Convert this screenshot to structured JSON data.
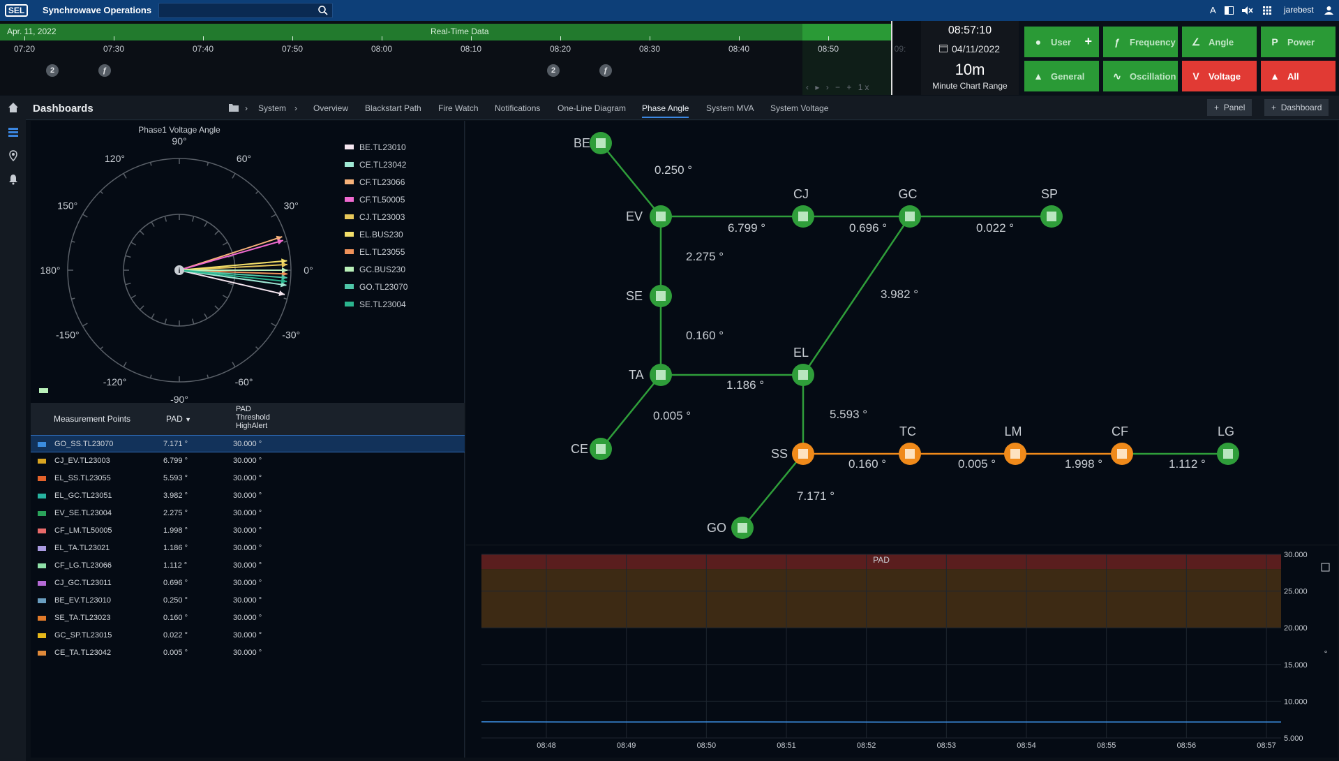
{
  "topbar": {
    "logo": "SEL",
    "app_title": "Synchrowave Operations",
    "search_placeholder": "",
    "text_size_icon": "A",
    "user": "jarebest"
  },
  "timeline": {
    "date": "Apr. 11, 2022",
    "mode": "Real-Time Data",
    "ticks": [
      "07:20",
      "07:30",
      "07:40",
      "07:50",
      "08:00",
      "08:10",
      "08:20",
      "08:30",
      "08:40",
      "08:50"
    ],
    "future_tick": "09:",
    "events": [
      "2",
      "ƒ",
      "2",
      "ƒ"
    ],
    "controls": "‹ ▸ › − + 1x"
  },
  "clock": {
    "time": "08:57:10",
    "date": "04/11/2022",
    "range": "10m",
    "range_label": "Minute Chart Range"
  },
  "alarms": [
    {
      "label": "User",
      "icon": "user-icon",
      "color": "green"
    },
    {
      "label": "Frequency",
      "icon": "frequency-icon",
      "color": "green"
    },
    {
      "label": "Angle",
      "icon": "angle-icon",
      "color": "green"
    },
    {
      "label": "Power",
      "icon": "power-icon",
      "color": "green"
    },
    {
      "label": "General",
      "icon": "bell-icon",
      "color": "green"
    },
    {
      "label": "Oscillation",
      "icon": "oscillation-icon",
      "color": "green"
    },
    {
      "label": "Voltage",
      "icon": "voltage-icon",
      "color": "red"
    },
    {
      "label": "All",
      "icon": "bell-icon",
      "color": "red"
    }
  ],
  "dashboard": {
    "title": "Dashboards",
    "crumb_root": "System",
    "tabs": [
      "Overview",
      "Blackstart Path",
      "Fire Watch",
      "Notifications",
      "One-Line Diagram",
      "Phase Angle",
      "System MVA",
      "System Voltage"
    ],
    "active_tab": "Phase Angle",
    "panel_btn": "Panel",
    "dashboard_btn": "Dashboard"
  },
  "polar": {
    "title": "Phase1 Voltage Angle",
    "angle_labels": [
      "90°",
      "60°",
      "30°",
      "0°",
      "-30°",
      "-60°",
      "-90°",
      "-120°",
      "-150°",
      "180°",
      "150°",
      "120°"
    ],
    "legend": [
      {
        "name": "BE.TL23010",
        "color": "#f5e6f0"
      },
      {
        "name": "CE.TL23042",
        "color": "#9fe8d4"
      },
      {
        "name": "CF.TL23066",
        "color": "#f7b27a"
      },
      {
        "name": "CF.TL50005",
        "color": "#f06ad0"
      },
      {
        "name": "CJ.TL23003",
        "color": "#e8c85a"
      },
      {
        "name": "EL.BUS230",
        "color": "#f3df6a"
      },
      {
        "name": "EL.TL23055",
        "color": "#f0925a"
      },
      {
        "name": "GC.BUS230",
        "color": "#b9f0b9"
      },
      {
        "name": "GO.TL23070",
        "color": "#4fc6a8"
      },
      {
        "name": "SE.TL23004",
        "color": "#2bb58e"
      }
    ]
  },
  "table": {
    "headers": {
      "point": "Measurement Points",
      "pad": "PAD",
      "threshold1": "PAD",
      "threshold2": "Threshold",
      "threshold3": "HighAlert"
    },
    "rows": [
      {
        "name": "GO_SS.TL23070",
        "pad": "7.171 °",
        "thr": "30.000 °",
        "color": "#3b8de0",
        "selected": true
      },
      {
        "name": "CJ_EV.TL23003",
        "pad": "6.799 °",
        "thr": "30.000 °",
        "color": "#d9a521"
      },
      {
        "name": "EL_SS.TL23055",
        "pad": "5.593 °",
        "thr": "30.000 °",
        "color": "#e2622b"
      },
      {
        "name": "EL_GC.TL23051",
        "pad": "3.982 °",
        "thr": "30.000 °",
        "color": "#27b3a0"
      },
      {
        "name": "EV_SE.TL23004",
        "pad": "2.275 °",
        "thr": "30.000 °",
        "color": "#2aa35a"
      },
      {
        "name": "CF_LM.TL50005",
        "pad": "1.998 °",
        "thr": "30.000 °",
        "color": "#e86a6a"
      },
      {
        "name": "EL_TA.TL23021",
        "pad": "1.186 °",
        "thr": "30.000 °",
        "color": "#a99ae0"
      },
      {
        "name": "CF_LG.TL23066",
        "pad": "1.112 °",
        "thr": "30.000 °",
        "color": "#8fe0a8"
      },
      {
        "name": "CJ_GC.TL23011",
        "pad": "0.696 °",
        "thr": "30.000 °",
        "color": "#b56ad6"
      },
      {
        "name": "BE_EV.TL23010",
        "pad": "0.250 °",
        "thr": "30.000 °",
        "color": "#6a9ec0"
      },
      {
        "name": "SE_TA.TL23023",
        "pad": "0.160 °",
        "thr": "30.000 °",
        "color": "#e07a2a"
      },
      {
        "name": "GC_SP.TL23015",
        "pad": "0.022 °",
        "thr": "30.000 °",
        "color": "#e6b81a"
      },
      {
        "name": "CE_TA.TL23042",
        "pad": "0.005 °",
        "thr": "30.000 °",
        "color": "#e08a3a"
      }
    ]
  },
  "network": {
    "nodes": [
      {
        "id": "BE",
        "color": "green"
      },
      {
        "id": "EV",
        "color": "green"
      },
      {
        "id": "CJ",
        "color": "green"
      },
      {
        "id": "GC",
        "color": "green"
      },
      {
        "id": "SP",
        "color": "green"
      },
      {
        "id": "SE",
        "color": "green"
      },
      {
        "id": "TA",
        "color": "green"
      },
      {
        "id": "EL",
        "color": "green"
      },
      {
        "id": "CE",
        "color": "green"
      },
      {
        "id": "SS",
        "color": "orange"
      },
      {
        "id": "TC",
        "color": "orange"
      },
      {
        "id": "LM",
        "color": "orange"
      },
      {
        "id": "CF",
        "color": "orange"
      },
      {
        "id": "LG",
        "color": "green"
      },
      {
        "id": "GO",
        "color": "green"
      }
    ],
    "edges": [
      {
        "from": "BE",
        "to": "EV",
        "label": "0.250 °",
        "color": "green"
      },
      {
        "from": "EV",
        "to": "CJ",
        "label": "6.799 °",
        "color": "green"
      },
      {
        "from": "CJ",
        "to": "GC",
        "label": "0.696 °",
        "color": "green"
      },
      {
        "from": "GC",
        "to": "SP",
        "label": "0.022 °",
        "color": "green"
      },
      {
        "from": "EV",
        "to": "SE",
        "label": "2.275 °",
        "color": "green"
      },
      {
        "from": "GC",
        "to": "EL",
        "label": "3.982 °",
        "color": "green"
      },
      {
        "from": "SE",
        "to": "TA",
        "label": "0.160 °",
        "color": "green"
      },
      {
        "from": "TA",
        "to": "EL",
        "label": "1.186 °",
        "color": "green"
      },
      {
        "from": "TA",
        "to": "CE",
        "label": "0.005 °",
        "color": "green"
      },
      {
        "from": "EL",
        "to": "SS",
        "label": "5.593 °",
        "color": "green"
      },
      {
        "from": "SS",
        "to": "TC",
        "label": "0.160 °",
        "color": "orange"
      },
      {
        "from": "TC",
        "to": "LM",
        "label": "0.005 °",
        "color": "orange"
      },
      {
        "from": "LM",
        "to": "CF",
        "label": "1.998 °",
        "color": "orange"
      },
      {
        "from": "CF",
        "to": "LG",
        "label": "1.112 °",
        "color": "green"
      },
      {
        "from": "SS",
        "to": "GO",
        "label": "7.171 °",
        "color": "green"
      }
    ]
  },
  "chart_data": {
    "type": "line",
    "title": "PAD",
    "unit": "°",
    "x": [
      "08:48",
      "08:49",
      "08:50",
      "08:51",
      "08:52",
      "08:53",
      "08:54",
      "08:55",
      "08:56",
      "08:57"
    ],
    "yticks": [
      "30.000",
      "25.000",
      "20.000",
      "15.000",
      "10.000",
      "5.000"
    ],
    "ylim": [
      5,
      30
    ],
    "alert_band": [
      20,
      30
    ],
    "series": [
      {
        "values": [
          7.2,
          7.18,
          7.17,
          7.19,
          7.17,
          7.16,
          7.18,
          7.17,
          7.18,
          7.17
        ]
      }
    ],
    "colors": {
      "line": "#3b8de0",
      "high": "#5a1e1e",
      "warn": "#3d2a14"
    }
  }
}
